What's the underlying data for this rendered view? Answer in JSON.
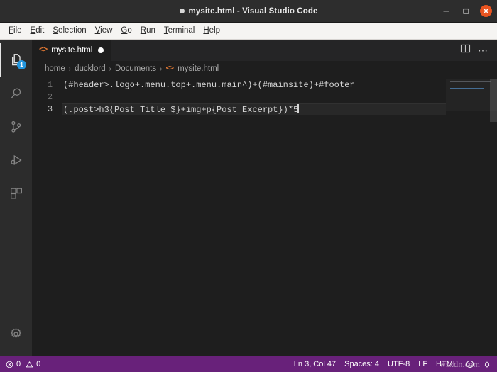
{
  "window": {
    "title": "mysite.html - Visual Studio Code",
    "dirty": true,
    "controls": {
      "minimize": "minimize-button",
      "maximize": "maximize-button",
      "close": "close-button"
    },
    "accent_close": "#e95420",
    "titlebar_bg": "#2d2d2d"
  },
  "menubar": {
    "items": [
      {
        "label": "File",
        "accel": "F",
        "rest": "ile"
      },
      {
        "label": "Edit",
        "accel": "E",
        "rest": "dit"
      },
      {
        "label": "Selection",
        "accel": "S",
        "rest": "election"
      },
      {
        "label": "View",
        "accel": "V",
        "rest": "iew"
      },
      {
        "label": "Go",
        "accel": "G",
        "rest": "o"
      },
      {
        "label": "Run",
        "accel": "R",
        "rest": "un"
      },
      {
        "label": "Terminal",
        "accel": "T",
        "rest": "erminal"
      },
      {
        "label": "Help",
        "accel": "H",
        "rest": "elp"
      }
    ]
  },
  "activitybar": {
    "items": [
      {
        "name": "explorer",
        "icon": "files-icon",
        "active": true,
        "badge": "1"
      },
      {
        "name": "search",
        "icon": "search-icon",
        "active": false,
        "badge": ""
      },
      {
        "name": "source-control",
        "icon": "source-control-icon",
        "active": false,
        "badge": ""
      },
      {
        "name": "run-debug",
        "icon": "run-debug-icon",
        "active": false,
        "badge": ""
      },
      {
        "name": "extensions",
        "icon": "extensions-icon",
        "active": false,
        "badge": ""
      }
    ],
    "bottom": {
      "name": "manage",
      "icon": "gear-icon"
    }
  },
  "editor": {
    "tab": {
      "icon": "html-file-icon",
      "icon_glyph": "<>",
      "label": "mysite.html",
      "dirty": true
    },
    "actions": {
      "split": "split-editor-icon",
      "more": "more-actions-icon",
      "more_glyph": "⋯"
    },
    "breadcrumb": {
      "segments": [
        "home",
        "ducklord",
        "Documents"
      ],
      "file": "mysite.html",
      "file_icon_glyph": "<>",
      "separator": "›"
    },
    "lines": [
      {
        "num": "1",
        "text": "(#header>.logo+.menu.top+.menu.main^)+(#mainsite)+#footer",
        "current": false
      },
      {
        "num": "2",
        "text": "",
        "current": false
      },
      {
        "num": "3",
        "text": "(.post>h3{Post Title $}+img+p{Post Excerpt})*5",
        "current": true
      }
    ],
    "minimap": {
      "rows": [
        {
          "width": 58,
          "highlight": false
        },
        {
          "width": 0,
          "highlight": false
        },
        {
          "width": 48,
          "highlight": true
        }
      ]
    }
  },
  "statusbar": {
    "bg": "#68217a",
    "errors": "0",
    "warnings": "0",
    "position": "Ln 3, Col 47",
    "indentation": "Spaces: 4",
    "encoding": "UTF-8",
    "eol": "LF",
    "language": "HTML",
    "feedback_icon": "feedback-smiley-icon",
    "notifications_icon": "bell-icon"
  },
  "overlay": {
    "watermark": "wsxdn.com"
  }
}
